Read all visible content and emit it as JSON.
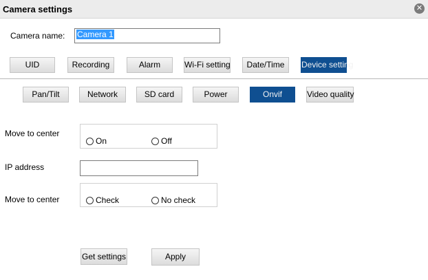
{
  "window": {
    "title": "Camera settings"
  },
  "camera": {
    "name_label": "Camera name:",
    "name_value": "Camera 1"
  },
  "main_tabs": [
    "UID",
    "Recording",
    "Alarm",
    "Wi-Fi setting",
    "Date/Time",
    "Device setting"
  ],
  "active_main_tab": "Device setting",
  "sub_tabs": [
    "Pan/Tilt",
    "Network",
    "SD card",
    "Power",
    "Onvif",
    "Video quality"
  ],
  "active_sub_tab": "Onvif",
  "onvif": {
    "move_to_center_label": "Move to center",
    "on_label": "On",
    "off_label": "Off",
    "ip_label": "IP address",
    "ip_value": "",
    "move_to_center_check_label": "Move to center",
    "check_label": "Check",
    "no_check_label": "No check"
  },
  "buttons": {
    "get_settings": "Get settings",
    "apply": "Apply"
  },
  "colors": {
    "active_tab": "#0f4f91",
    "selection": "#3399ff",
    "titlebar": "#ececec"
  }
}
